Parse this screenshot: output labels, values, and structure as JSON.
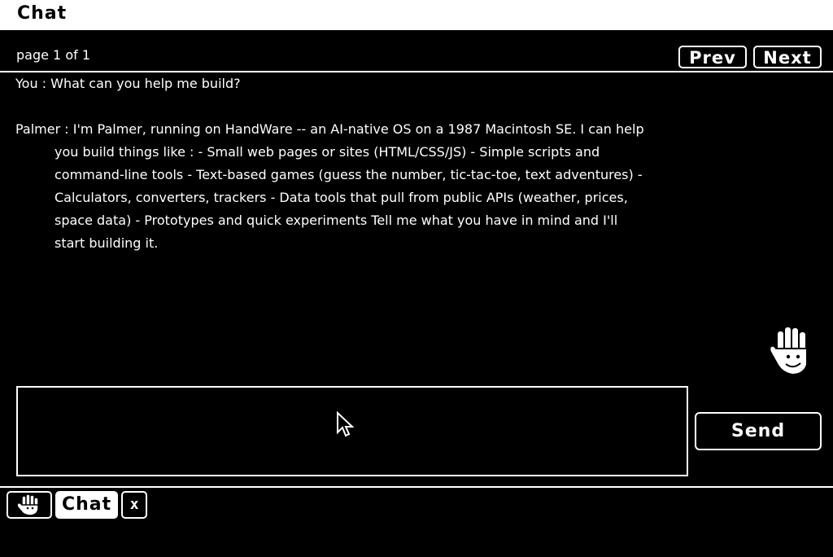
{
  "window": {
    "title": "Chat"
  },
  "pager": {
    "indicator": "page 1 of 1",
    "prev_label": "Prev",
    "next_label": "Next"
  },
  "messages": [
    {
      "speaker": "You",
      "text": "You : What can you help me build?"
    },
    {
      "speaker": "Palmer",
      "text": "Palmer : I'm Palmer, running on HandWare -- an AI-native OS on a 1987 Macintosh SE. I can help you build things like : - Small web pages or sites (HTML/CSS/JS) - Simple scripts and command-line tools - Text-based games (guess the number, tic-tac-toe, text adventures) - Calculators, converters, trackers - Data tools that pull from public APIs (weather, prices, space data) - Prototypes and quick experiments  Tell me what you have in mind and I'll start building it."
    }
  ],
  "composer": {
    "value": "",
    "placeholder": "",
    "send_label": "Send"
  },
  "mascot": {
    "icon": "waving-hand-icon"
  },
  "taskbar": {
    "app_icon": "hand-app-icon",
    "active_tab_label": "Chat",
    "close_label": "x"
  },
  "colors": {
    "background": "#000000",
    "foreground": "#ffffff"
  }
}
